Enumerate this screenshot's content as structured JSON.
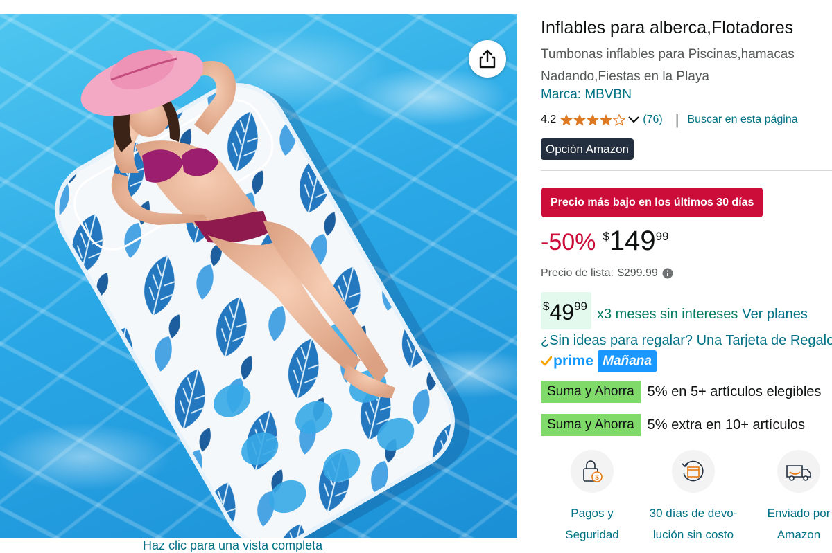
{
  "image_pane": {
    "share_icon": "share-icon",
    "full_view_link": "Haz clic para una vista completa"
  },
  "product": {
    "title": "Inflables para alberca,Flotadores",
    "subtitle_line1": "Tumbonas inflables para Piscinas,hamacas",
    "subtitle_line2": "Nadando,Fiestas en la Playa",
    "brand": "Marca: MBVBN",
    "rating_value": "4.2",
    "rating_stars": 4.2,
    "rating_count": "(76)",
    "search_link": "Buscar en esta página",
    "choice_badge": "Opción Amazon"
  },
  "pricing": {
    "deal_badge": "Precio más bajo en los últimos 30 días",
    "discount": "-50%",
    "currency": "$",
    "price_whole": "149",
    "price_fraction": "99",
    "list_price_label": "Precio de lista:",
    "list_price": "$299.99",
    "installment_currency": "$",
    "installment_whole": "49",
    "installment_fraction": "99",
    "installment_text": "x3 meses sin intereses",
    "installment_plans": "Ver planes",
    "gift_link": "¿Sin ideas para regalar? Una Tarjeta de Regalo"
  },
  "delivery": {
    "prime_label": "prime",
    "delivery_day": "Mañana"
  },
  "promotions": [
    {
      "badge": "Suma y Ahorra",
      "text": "5% en 5+ artículos elegibles"
    },
    {
      "badge": "Suma y Ahorra",
      "text": "5% extra en 10+ artículos"
    }
  ],
  "trust": [
    {
      "icon": "secure-payment-icon",
      "line1": "Pagos y",
      "line2": "Seguridad"
    },
    {
      "icon": "return-box-icon",
      "line1": "30 días de devo-",
      "line2": "lución sin costo"
    },
    {
      "icon": "delivery-truck-icon",
      "line1": "Enviado por",
      "line2": "Amazon"
    }
  ],
  "colors": {
    "link": "#007185",
    "deal_red": "#cc0c39",
    "badge_dark": "#232f3e",
    "prime_blue": "#1399ff",
    "promo_green": "#7fda69",
    "installment_bg": "#e3f9ee",
    "installment_green": "#067d62",
    "pool_water": "#2aa8e6",
    "float_leaf": "#1f6fb3"
  }
}
